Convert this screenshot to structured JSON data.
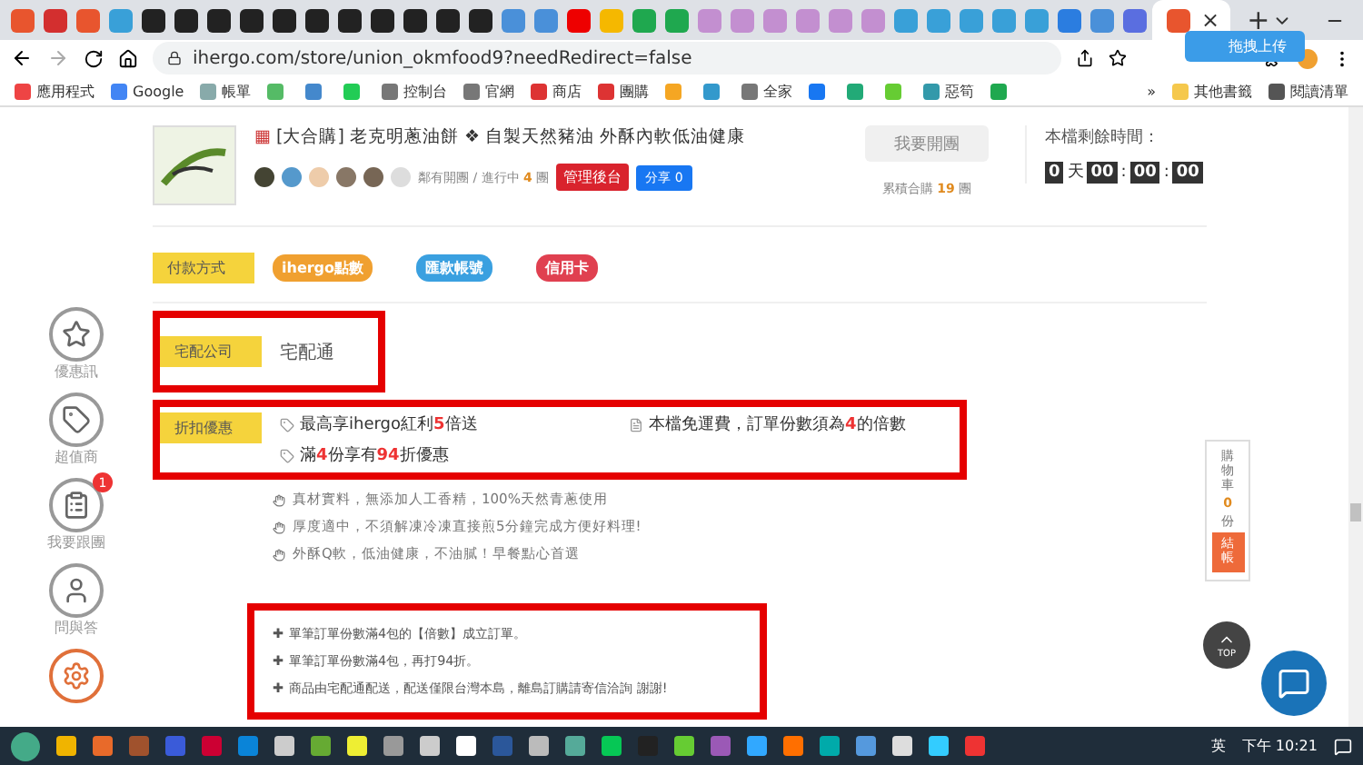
{
  "browser": {
    "tabs": [
      {
        "selected": false
      },
      {
        "selected": false
      },
      {
        "selected": false
      },
      {
        "selected": false
      },
      {
        "selected": false
      },
      {
        "selected": false
      },
      {
        "selected": false
      },
      {
        "selected": false
      },
      {
        "selected": false
      },
      {
        "selected": false
      },
      {
        "selected": false
      },
      {
        "selected": false
      },
      {
        "selected": false
      },
      {
        "selected": false
      },
      {
        "selected": false
      },
      {
        "selected": false
      },
      {
        "selected": false
      },
      {
        "selected": false
      },
      {
        "selected": false
      },
      {
        "selected": false
      },
      {
        "selected": false
      },
      {
        "selected": false
      },
      {
        "selected": false
      },
      {
        "selected": false
      },
      {
        "selected": false
      },
      {
        "selected": false
      },
      {
        "selected": false
      },
      {
        "selected": false
      },
      {
        "selected": false
      },
      {
        "selected": false
      },
      {
        "selected": false
      },
      {
        "selected": false
      },
      {
        "selected": false
      },
      {
        "selected": false
      },
      {
        "selected": false
      },
      {
        "selected": true
      }
    ],
    "tab_close": "×",
    "new_tab": "+",
    "address": "ihergo.com/store/union_okmfood9?needRedirect=false",
    "extension_popup": "拖拽上传",
    "bookmarks": [
      {
        "kind": "link",
        "label": "應用程式"
      },
      {
        "kind": "link",
        "label": "Google"
      },
      {
        "kind": "link",
        "label": "帳單"
      },
      {
        "kind": "icon"
      },
      {
        "kind": "icon"
      },
      {
        "kind": "icon"
      },
      {
        "kind": "link",
        "label": "控制台"
      },
      {
        "kind": "link",
        "label": "官網"
      },
      {
        "kind": "link",
        "label": "商店"
      },
      {
        "kind": "link",
        "label": "團購"
      },
      {
        "kind": "icon"
      },
      {
        "kind": "icon"
      },
      {
        "kind": "link",
        "label": "全家"
      },
      {
        "kind": "icon"
      },
      {
        "kind": "icon"
      },
      {
        "kind": "icon"
      },
      {
        "kind": "link",
        "label": "惡筍"
      },
      {
        "kind": "icon"
      }
    ],
    "bookmarks_more": "»",
    "other_bookmarks": "其他書籤",
    "reading_list": "閱讀清單"
  },
  "header": {
    "title_badge": "▦",
    "title": "[大合購] 老克明蔥油餅 ❖ 自製天然豬油 外酥內軟低油健康",
    "groups": {
      "prefix": "鄰有開團 / 進行中",
      "count": "4",
      "suffix": "團"
    },
    "admin_button": "管理後台",
    "share_button": "分享 0",
    "open_button": {
      "label": "我要開團",
      "disabled": true
    },
    "total": {
      "prefix": "累積合購",
      "count": "19",
      "suffix": "團"
    },
    "timer": {
      "label": "本檔剩餘時間：",
      "days": "0",
      "day_unit": "天",
      "parts": [
        "00",
        "00",
        "00"
      ],
      "separator": ":"
    }
  },
  "payment": {
    "label": "付款方式",
    "methods": [
      {
        "label": "ihergo點數",
        "color": "#f0a030"
      },
      {
        "label": "匯款帳號",
        "color": "#3aa0e0"
      },
      {
        "label": "信用卡",
        "color": "#e04050"
      }
    ]
  },
  "delivery": {
    "label": "宅配公司",
    "value": "宅配通"
  },
  "discount": {
    "label": "折扣優惠",
    "items": [
      {
        "kind": "tag",
        "parts": [
          {
            "text": "最高享ihergo紅利",
            "highlight": false
          },
          {
            "text": "5",
            "highlight": true
          },
          {
            "text": "倍送",
            "highlight": false
          }
        ]
      },
      {
        "kind": "doc",
        "parts": [
          {
            "text": "本檔免運費，訂單份數須為",
            "highlight": false
          },
          {
            "text": "4",
            "highlight": true
          },
          {
            "text": "的倍數",
            "highlight": false
          }
        ]
      },
      {
        "kind": "tag",
        "parts": [
          {
            "text": "滿",
            "highlight": false
          },
          {
            "text": "4",
            "highlight": true
          },
          {
            "text": "份享有",
            "highlight": false
          },
          {
            "text": "94",
            "highlight": true
          },
          {
            "text": "折優惠",
            "highlight": false
          }
        ]
      }
    ]
  },
  "features": [
    "真材實料，無添加人工香精，100%天然青蔥使用",
    "厚度適中，不須解凍冷凍直接煎5分鐘完成方便好料理!",
    "外酥Q軟，低油健康，不油膩！早餐點心首選"
  ],
  "notes": {
    "bullet": "✚",
    "items": [
      "單筆訂單份數滿4包的【倍數】成立訂單。",
      "單筆訂單份數滿4包，再打94折。",
      "商品由宅配通配送，配送僅限台灣本島，離島訂購請寄信洽詢 謝謝!"
    ]
  },
  "side_nav": [
    {
      "kind": "star",
      "label": "優惠訊"
    },
    {
      "kind": "tag",
      "label": "超值商"
    },
    {
      "kind": "clipboard",
      "label": "我要跟團",
      "badge": "1"
    },
    {
      "kind": "person",
      "label": "問與答"
    },
    {
      "kind": "gear"
    }
  ],
  "cart": {
    "label": "購物車",
    "count": "0",
    "unit": "份",
    "checkout": "結帳"
  },
  "top_button": "TOP",
  "taskbar": {
    "ime": "英",
    "clock": "下午 10:21"
  }
}
